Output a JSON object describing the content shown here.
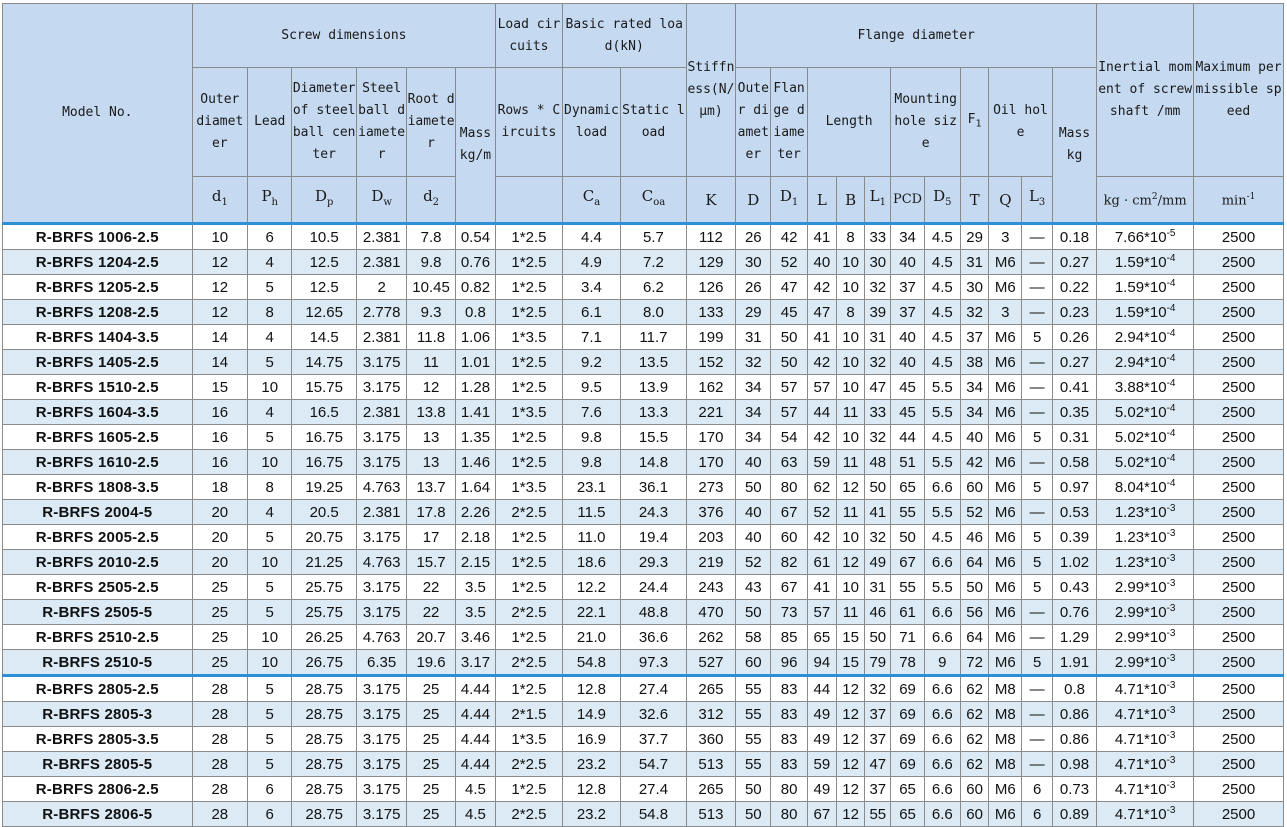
{
  "header": {
    "model_no": "Model No.",
    "screw_dimensions": "Screw dimensions",
    "load_circuits": "Load circuits",
    "basic_rated_load": "Basic rated load(kN)",
    "stiffness": "Stiffness(N/μm)",
    "flange_diameter": "Flange diameter",
    "inertial_moment": "Inertial moment of screw shaft /mm",
    "max_speed": "Maximum permissible speed",
    "outer_diameter": "Outer diameter",
    "lead": "Lead",
    "ball_center_diameter": "Diameter of steel ball center",
    "steel_ball_diameter": "Steel ball diameter",
    "root_diameter": "Root diameter",
    "mass_kg_m": "Mass kg/m",
    "rows_circuits": "Rows * Circuits",
    "dynamic_load": "Dynamic load",
    "static_load": "Static load",
    "flange_outer_diameter": "Outer diameter",
    "flange_dia": "Flange diameter",
    "length": "Length",
    "mounting_hole_size": "Mounting hole size",
    "f1": "F",
    "oil_hole": "Oil hole",
    "mass_kg": "Mass kg",
    "sym_d1": "d",
    "sym_d1_sub": "1",
    "sym_ph": "P",
    "sym_ph_sub": "h",
    "sym_dp": "D",
    "sym_dp_sub": "p",
    "sym_dw": "D",
    "sym_dw_sub": "w",
    "sym_d2": "d",
    "sym_d2_sub": "2",
    "sym_ca": "C",
    "sym_ca_sub": "a",
    "sym_coa": "C",
    "sym_coa_sub": "oa",
    "sym_k": "K",
    "sym_D": "D",
    "sym_D1": "D",
    "sym_D1_sub": "1",
    "sym_L": "L",
    "sym_B": "B",
    "sym_L1": "L",
    "sym_L1_sub": "1",
    "sym_pcd": "PCD",
    "sym_D5": "D",
    "sym_D5_sub": "5",
    "sym_T": "T",
    "sym_Q": "Q",
    "sym_L3": "L",
    "sym_L3_sub": "3",
    "f1_sub": "1",
    "unit_inertia": "kg · cm",
    "unit_inertia_sup": "2",
    "unit_inertia_tail": "/mm",
    "unit_speed": "min",
    "unit_speed_sup": "-1"
  },
  "rows": [
    {
      "model": "R-BRFS  1006-2.5",
      "d1": "10",
      "ph": "6",
      "dp": "10.5",
      "dw": "2.381",
      "d2": "7.8",
      "mass": "0.54",
      "rc": "1*2.5",
      "ca": "4.4",
      "coa": "5.7",
      "k": "112",
      "D": "26",
      "D1": "42",
      "L": "41",
      "B": "8",
      "L1": "33",
      "pcd": "34",
      "D5": "4.5",
      "T": "29",
      "Q": "3",
      "L3": "—",
      "fmass": "0.18",
      "inertia": "7.66*10",
      "exp": "-5",
      "speed": "2500"
    },
    {
      "model": "R-BRFS  1204-2.5",
      "d1": "12",
      "ph": "4",
      "dp": "12.5",
      "dw": "2.381",
      "d2": "9.8",
      "mass": "0.76",
      "rc": "1*2.5",
      "ca": "4.9",
      "coa": "7.2",
      "k": "129",
      "D": "30",
      "D1": "52",
      "L": "40",
      "B": "10",
      "L1": "30",
      "pcd": "40",
      "D5": "4.5",
      "T": "31",
      "Q": "M6",
      "L3": "—",
      "fmass": "0.27",
      "inertia": "1.59*10",
      "exp": "-4",
      "speed": "2500"
    },
    {
      "model": "R-BRFS  1205-2.5",
      "d1": "12",
      "ph": "5",
      "dp": "12.5",
      "dw": "2",
      "d2": "10.45",
      "mass": "0.82",
      "rc": "1*2.5",
      "ca": "3.4",
      "coa": "6.2",
      "k": "126",
      "D": "26",
      "D1": "47",
      "L": "42",
      "B": "10",
      "L1": "32",
      "pcd": "37",
      "D5": "4.5",
      "T": "30",
      "Q": "M6",
      "L3": "—",
      "fmass": "0.22",
      "inertia": "1.59*10",
      "exp": "-4",
      "speed": "2500"
    },
    {
      "model": "R-BRFS  1208-2.5",
      "d1": "12",
      "ph": "8",
      "dp": "12.65",
      "dw": "2.778",
      "d2": "9.3",
      "mass": "0.8",
      "rc": "1*2.5",
      "ca": "6.1",
      "coa": "8.0",
      "k": "133",
      "D": "29",
      "D1": "45",
      "L": "47",
      "B": "8",
      "L1": "39",
      "pcd": "37",
      "D5": "4.5",
      "T": "32",
      "Q": "3",
      "L3": "—",
      "fmass": "0.23",
      "inertia": "1.59*10",
      "exp": "-4",
      "speed": "2500"
    },
    {
      "model": "R-BRFS  1404-3.5",
      "d1": "14",
      "ph": "4",
      "dp": "14.5",
      "dw": "2.381",
      "d2": "11.8",
      "mass": "1.06",
      "rc": "1*3.5",
      "ca": "7.1",
      "coa": "11.7",
      "k": "199",
      "D": "31",
      "D1": "50",
      "L": "41",
      "B": "10",
      "L1": "31",
      "pcd": "40",
      "D5": "4.5",
      "T": "37",
      "Q": "M6",
      "L3": "5",
      "fmass": "0.26",
      "inertia": "2.94*10",
      "exp": "-4",
      "speed": "2500"
    },
    {
      "model": "R-BRFS  1405-2.5",
      "d1": "14",
      "ph": "5",
      "dp": "14.75",
      "dw": "3.175",
      "d2": "11",
      "mass": "1.01",
      "rc": "1*2.5",
      "ca": "9.2",
      "coa": "13.5",
      "k": "152",
      "D": "32",
      "D1": "50",
      "L": "42",
      "B": "10",
      "L1": "32",
      "pcd": "40",
      "D5": "4.5",
      "T": "38",
      "Q": "M6",
      "L3": "—",
      "fmass": "0.27",
      "inertia": "2.94*10",
      "exp": "-4",
      "speed": "2500"
    },
    {
      "model": "R-BRFS  1510-2.5",
      "d1": "15",
      "ph": "10",
      "dp": "15.75",
      "dw": "3.175",
      "d2": "12",
      "mass": "1.28",
      "rc": "1*2.5",
      "ca": "9.5",
      "coa": "13.9",
      "k": "162",
      "D": "34",
      "D1": "57",
      "L": "57",
      "B": "10",
      "L1": "47",
      "pcd": "45",
      "D5": "5.5",
      "T": "34",
      "Q": "M6",
      "L3": "—",
      "fmass": "0.41",
      "inertia": "3.88*10",
      "exp": "-4",
      "speed": "2500"
    },
    {
      "model": "R-BRFS  1604-3.5",
      "d1": "16",
      "ph": "4",
      "dp": "16.5",
      "dw": "2.381",
      "d2": "13.8",
      "mass": "1.41",
      "rc": "1*3.5",
      "ca": "7.6",
      "coa": "13.3",
      "k": "221",
      "D": "34",
      "D1": "57",
      "L": "44",
      "B": "11",
      "L1": "33",
      "pcd": "45",
      "D5": "5.5",
      "T": "34",
      "Q": "M6",
      "L3": "—",
      "fmass": "0.35",
      "inertia": "5.02*10",
      "exp": "-4",
      "speed": "2500"
    },
    {
      "model": "R-BRFS  1605-2.5",
      "d1": "16",
      "ph": "5",
      "dp": "16.75",
      "dw": "3.175",
      "d2": "13",
      "mass": "1.35",
      "rc": "1*2.5",
      "ca": "9.8",
      "coa": "15.5",
      "k": "170",
      "D": "34",
      "D1": "54",
      "L": "42",
      "B": "10",
      "L1": "32",
      "pcd": "44",
      "D5": "4.5",
      "T": "40",
      "Q": "M6",
      "L3": "5",
      "fmass": "0.31",
      "inertia": "5.02*10",
      "exp": "-4",
      "speed": "2500"
    },
    {
      "model": "R-BRFS  1610-2.5",
      "d1": "16",
      "ph": "10",
      "dp": "16.75",
      "dw": "3.175",
      "d2": "13",
      "mass": "1.46",
      "rc": "1*2.5",
      "ca": "9.8",
      "coa": "14.8",
      "k": "170",
      "D": "40",
      "D1": "63",
      "L": "59",
      "B": "11",
      "L1": "48",
      "pcd": "51",
      "D5": "5.5",
      "T": "42",
      "Q": "M6",
      "L3": "—",
      "fmass": "0.58",
      "inertia": "5.02*10",
      "exp": "-4",
      "speed": "2500"
    },
    {
      "model": "R-BRFS  1808-3.5",
      "d1": "18",
      "ph": "8",
      "dp": "19.25",
      "dw": "4.763",
      "d2": "13.7",
      "mass": "1.64",
      "rc": "1*3.5",
      "ca": "23.1",
      "coa": "36.1",
      "k": "273",
      "D": "50",
      "D1": "80",
      "L": "62",
      "B": "12",
      "L1": "50",
      "pcd": "65",
      "D5": "6.6",
      "T": "60",
      "Q": "M6",
      "L3": "5",
      "fmass": "0.97",
      "inertia": "8.04*10",
      "exp": "-4",
      "speed": "2500"
    },
    {
      "model": "R-BRFS  2004-5",
      "d1": "20",
      "ph": "4",
      "dp": "20.5",
      "dw": "2.381",
      "d2": "17.8",
      "mass": "2.26",
      "rc": "2*2.5",
      "ca": "11.5",
      "coa": "24.3",
      "k": "376",
      "D": "40",
      "D1": "67",
      "L": "52",
      "B": "11",
      "L1": "41",
      "pcd": "55",
      "D5": "5.5",
      "T": "52",
      "Q": "M6",
      "L3": "—",
      "fmass": "0.53",
      "inertia": "1.23*10",
      "exp": "-3",
      "speed": "2500"
    },
    {
      "model": "R-BRFS  2005-2.5",
      "d1": "20",
      "ph": "5",
      "dp": "20.75",
      "dw": "3.175",
      "d2": "17",
      "mass": "2.18",
      "rc": "1*2.5",
      "ca": "11.0",
      "coa": "19.4",
      "k": "203",
      "D": "40",
      "D1": "60",
      "L": "42",
      "B": "10",
      "L1": "32",
      "pcd": "50",
      "D5": "4.5",
      "T": "46",
      "Q": "M6",
      "L3": "5",
      "fmass": "0.39",
      "inertia": "1.23*10",
      "exp": "-3",
      "speed": "2500"
    },
    {
      "model": "R-BRFS  2010-2.5",
      "d1": "20",
      "ph": "10",
      "dp": "21.25",
      "dw": "4.763",
      "d2": "15.7",
      "mass": "2.15",
      "rc": "1*2.5",
      "ca": "18.6",
      "coa": "29.3",
      "k": "219",
      "D": "52",
      "D1": "82",
      "L": "61",
      "B": "12",
      "L1": "49",
      "pcd": "67",
      "D5": "6.6",
      "T": "64",
      "Q": "M6",
      "L3": "5",
      "fmass": "1.02",
      "inertia": "1.23*10",
      "exp": "-3",
      "speed": "2500"
    },
    {
      "model": "R-BRFS  2505-2.5",
      "d1": "25",
      "ph": "5",
      "dp": "25.75",
      "dw": "3.175",
      "d2": "22",
      "mass": "3.5",
      "rc": "1*2.5",
      "ca": "12.2",
      "coa": "24.4",
      "k": "243",
      "D": "43",
      "D1": "67",
      "L": "41",
      "B": "10",
      "L1": "31",
      "pcd": "55",
      "D5": "5.5",
      "T": "50",
      "Q": "M6",
      "L3": "5",
      "fmass": "0.43",
      "inertia": "2.99*10",
      "exp": "-3",
      "speed": "2500"
    },
    {
      "model": "R-BRFS  2505-5",
      "d1": "25",
      "ph": "5",
      "dp": "25.75",
      "dw": "3.175",
      "d2": "22",
      "mass": "3.5",
      "rc": "2*2.5",
      "ca": "22.1",
      "coa": "48.8",
      "k": "470",
      "D": "50",
      "D1": "73",
      "L": "57",
      "B": "11",
      "L1": "46",
      "pcd": "61",
      "D5": "6.6",
      "T": "56",
      "Q": "M6",
      "L3": "—",
      "fmass": "0.76",
      "inertia": "2.99*10",
      "exp": "-3",
      "speed": "2500"
    },
    {
      "model": "R-BRFS  2510-2.5",
      "d1": "25",
      "ph": "10",
      "dp": "26.25",
      "dw": "4.763",
      "d2": "20.7",
      "mass": "3.46",
      "rc": "1*2.5",
      "ca": "21.0",
      "coa": "36.6",
      "k": "262",
      "D": "58",
      "D1": "85",
      "L": "65",
      "B": "15",
      "L1": "50",
      "pcd": "71",
      "D5": "6.6",
      "T": "64",
      "Q": "M6",
      "L3": "—",
      "fmass": "1.29",
      "inertia": "2.99*10",
      "exp": "-3",
      "speed": "2500"
    },
    {
      "model": "R-BRFS  2510-5",
      "d1": "25",
      "ph": "10",
      "dp": "26.75",
      "dw": "6.35",
      "d2": "19.6",
      "mass": "3.17",
      "rc": "2*2.5",
      "ca": "54.8",
      "coa": "97.3",
      "k": "527",
      "D": "60",
      "D1": "96",
      "L": "94",
      "B": "15",
      "L1": "79",
      "pcd": "78",
      "D5": "9",
      "T": "72",
      "Q": "M6",
      "L3": "5",
      "fmass": "1.91",
      "inertia": "2.99*10",
      "exp": "-3",
      "speed": "2500"
    },
    {
      "model": "R-BRFS  2805-2.5",
      "d1": "28",
      "ph": "5",
      "dp": "28.75",
      "dw": "3.175",
      "d2": "25",
      "mass": "4.44",
      "rc": "1*2.5",
      "ca": "12.8",
      "coa": "27.4",
      "k": "265",
      "D": "55",
      "D1": "83",
      "L": "44",
      "B": "12",
      "L1": "32",
      "pcd": "69",
      "D5": "6.6",
      "T": "62",
      "Q": "M8",
      "L3": "—",
      "fmass": "0.8",
      "inertia": "4.71*10",
      "exp": "-3",
      "speed": "2500"
    },
    {
      "model": "R-BRFS  2805-3",
      "d1": "28",
      "ph": "5",
      "dp": "28.75",
      "dw": "3.175",
      "d2": "25",
      "mass": "4.44",
      "rc": "2*1.5",
      "ca": "14.9",
      "coa": "32.6",
      "k": "312",
      "D": "55",
      "D1": "83",
      "L": "49",
      "B": "12",
      "L1": "37",
      "pcd": "69",
      "D5": "6.6",
      "T": "62",
      "Q": "M8",
      "L3": "—",
      "fmass": "0.86",
      "inertia": "4.71*10",
      "exp": "-3",
      "speed": "2500"
    },
    {
      "model": "R-BRFS  2805-3.5",
      "d1": "28",
      "ph": "5",
      "dp": "28.75",
      "dw": "3.175",
      "d2": "25",
      "mass": "4.44",
      "rc": "1*3.5",
      "ca": "16.9",
      "coa": "37.7",
      "k": "360",
      "D": "55",
      "D1": "83",
      "L": "49",
      "B": "12",
      "L1": "37",
      "pcd": "69",
      "D5": "6.6",
      "T": "62",
      "Q": "M8",
      "L3": "—",
      "fmass": "0.86",
      "inertia": "4.71*10",
      "exp": "-3",
      "speed": "2500"
    },
    {
      "model": "R-BRFS  2805-5",
      "d1": "28",
      "ph": "5",
      "dp": "28.75",
      "dw": "3.175",
      "d2": "25",
      "mass": "4.44",
      "rc": "2*2.5",
      "ca": "23.2",
      "coa": "54.7",
      "k": "513",
      "D": "55",
      "D1": "83",
      "L": "59",
      "B": "12",
      "L1": "47",
      "pcd": "69",
      "D5": "6.6",
      "T": "62",
      "Q": "M8",
      "L3": "—",
      "fmass": "0.98",
      "inertia": "4.71*10",
      "exp": "-3",
      "speed": "2500"
    },
    {
      "model": "R-BRFS  2806-2.5",
      "d1": "28",
      "ph": "6",
      "dp": "28.75",
      "dw": "3.175",
      "d2": "25",
      "mass": "4.5",
      "rc": "1*2.5",
      "ca": "12.8",
      "coa": "27.4",
      "k": "265",
      "D": "50",
      "D1": "80",
      "L": "49",
      "B": "12",
      "L1": "37",
      "pcd": "65",
      "D5": "6.6",
      "T": "60",
      "Q": "M6",
      "L3": "6",
      "fmass": "0.73",
      "inertia": "4.71*10",
      "exp": "-3",
      "speed": "2500"
    },
    {
      "model": "R-BRFS  2806-5",
      "d1": "28",
      "ph": "6",
      "dp": "28.75",
      "dw": "3.175",
      "d2": "25",
      "mass": "4.5",
      "rc": "2*2.5",
      "ca": "23.2",
      "coa": "54.8",
      "k": "513",
      "D": "50",
      "D1": "80",
      "L": "67",
      "B": "12",
      "L1": "55",
      "pcd": "65",
      "D5": "6.6",
      "T": "60",
      "Q": "M6",
      "L3": "6",
      "fmass": "0.89",
      "inertia": "4.71*10",
      "exp": "-3",
      "speed": "2500"
    }
  ]
}
